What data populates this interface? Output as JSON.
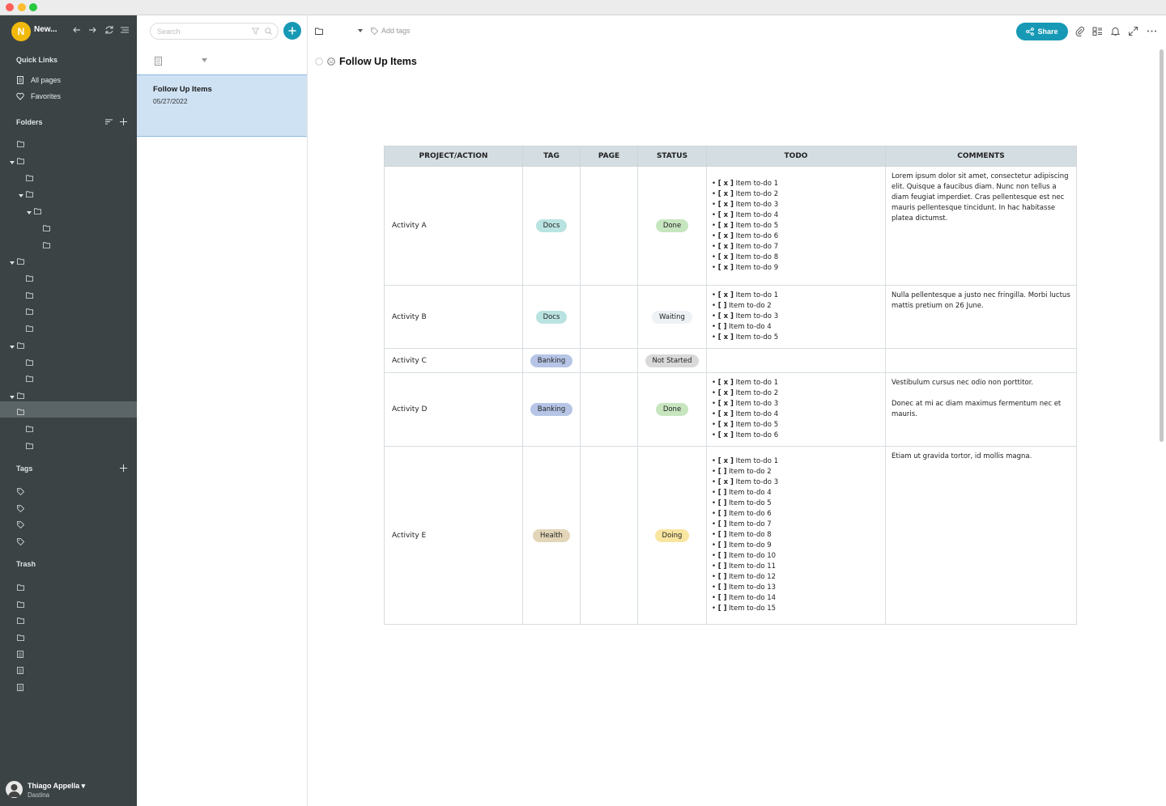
{
  "window": {
    "title": ""
  },
  "sidebar": {
    "workspace_initial": "N",
    "workspace_name": "New...",
    "quick_links_title": "Quick Links",
    "quick_links": [
      {
        "label": "All pages"
      },
      {
        "label": "Favorites"
      }
    ],
    "folders_title": "Folders",
    "tags_title": "Tags",
    "trash_title": "Trash",
    "user_name": "Thiago Appella",
    "user_org": "Dastina"
  },
  "list": {
    "search_placeholder": "Search",
    "items": [
      {
        "title": "Follow Up Items",
        "date": "05/27/2022"
      }
    ]
  },
  "header": {
    "add_tags": "Add tags",
    "share_label": "Share"
  },
  "page": {
    "title": "Follow Up Items"
  },
  "table": {
    "headers": [
      "PROJECT/ACTION",
      "TAG",
      "PAGE",
      "STATUS",
      "TODO",
      "COMMENTS"
    ],
    "rows": [
      {
        "name": "Activity A",
        "tag": "Docs",
        "status": "Done",
        "todos": [
          {
            "mark": "[ x ]",
            "text": "Item to-do 1"
          },
          {
            "mark": "[ x ]",
            "text": "Item to-do 2"
          },
          {
            "mark": "[ x ]",
            "text": "Item to-do 3"
          },
          {
            "mark": "[ x ]",
            "text": "Item to-do 4"
          },
          {
            "mark": "[ x ]",
            "text": "Item to-do 5"
          },
          {
            "mark": "[ x ]",
            "text": "Item to-do 6"
          },
          {
            "mark": "[ x ]",
            "text": "Item to-do 7"
          },
          {
            "mark": "[ x ]",
            "text": "Item to-do 8"
          },
          {
            "mark": "[ x ]",
            "text": "Item to-do 9"
          }
        ],
        "comments": [
          "Lorem ipsum dolor sit amet, consectetur adipiscing elit. Quisque a faucibus diam. Nunc non tellus a diam feugiat imperdiet. Cras pellentesque est nec mauris pellentesque tincidunt. In hac habitasse platea dictumst."
        ]
      },
      {
        "name": "Activity B",
        "tag": "Docs",
        "status": "Waiting",
        "todos": [
          {
            "mark": "[ x ]",
            "text": "Item to-do 1"
          },
          {
            "mark": "[  ]",
            "text": "Item to-do 2"
          },
          {
            "mark": "[ x ]",
            "text": "Item to-do 3"
          },
          {
            "mark": "[  ]",
            "text": "Item to-do 4"
          },
          {
            "mark": "[ x ]",
            "text": "Item to-do 5"
          }
        ],
        "comments": [
          "Nulla pellentesque a justo nec fringilla. Morbi luctus mattis pretium on 26 June."
        ]
      },
      {
        "name": "Activity C",
        "tag": "Banking",
        "status": "Not Started",
        "todos": [],
        "comments": []
      },
      {
        "name": "Activity D",
        "tag": "Banking",
        "status": "Done",
        "todos": [
          {
            "mark": "[ x ]",
            "text": "Item to-do 1"
          },
          {
            "mark": "[ x ]",
            "text": "Item to-do 2"
          },
          {
            "mark": "[ x ]",
            "text": "Item to-do 3"
          },
          {
            "mark": "[ x ]",
            "text": "Item to-do 4"
          },
          {
            "mark": "[ x ]",
            "text": "Item to-do 5"
          },
          {
            "mark": "[ x ]",
            "text": "Item to-do 6"
          }
        ],
        "comments": [
          "Vestibulum cursus nec odio non porttitor.",
          "Donec at mi ac diam maximus fermentum nec et mauris."
        ]
      },
      {
        "name": "Activity E",
        "tag": "Health",
        "status": "Doing",
        "todos": [
          {
            "mark": "[ x ]",
            "text": "Item to-do 1"
          },
          {
            "mark": "[  ]",
            "text": "Item to-do 2"
          },
          {
            "mark": "[ x ]",
            "text": "Item to-do 3"
          },
          {
            "mark": "[  ]",
            "text": "Item to-do 4"
          },
          {
            "mark": "[  ]",
            "text": "Item to-do 5"
          },
          {
            "mark": "[  ]",
            "text": "Item to-do 6"
          },
          {
            "mark": "[  ]",
            "text": "Item to-do 7"
          },
          {
            "mark": "[  ]",
            "text": "Item to-do 8"
          },
          {
            "mark": "[  ]",
            "text": "Item to-do 9"
          },
          {
            "mark": "[  ]",
            "text": "Item to-do 10"
          },
          {
            "mark": "[  ]",
            "text": "Item to-do 11"
          },
          {
            "mark": "[  ]",
            "text": "Item to-do 12"
          },
          {
            "mark": "[  ]",
            "text": "Item to-do 13"
          },
          {
            "mark": "[  ]",
            "text": "Item to-do 14"
          },
          {
            "mark": "[  ]",
            "text": "Item to-do 15"
          }
        ],
        "comments": [
          "Etiam ut gravida tortor, id mollis magna."
        ]
      }
    ]
  },
  "colors": {
    "accent": "#1799b5",
    "sidebar_bg": "#3b4345",
    "tag_docs": "#b9e3e0",
    "tag_banking": "#b6c5e6",
    "tag_health": "#e3d6b8",
    "status_done": "#c7e6bf",
    "status_waiting": "#eef1f5",
    "status_not_started": "#d9d9d9",
    "status_doing": "#f8e5a0"
  }
}
